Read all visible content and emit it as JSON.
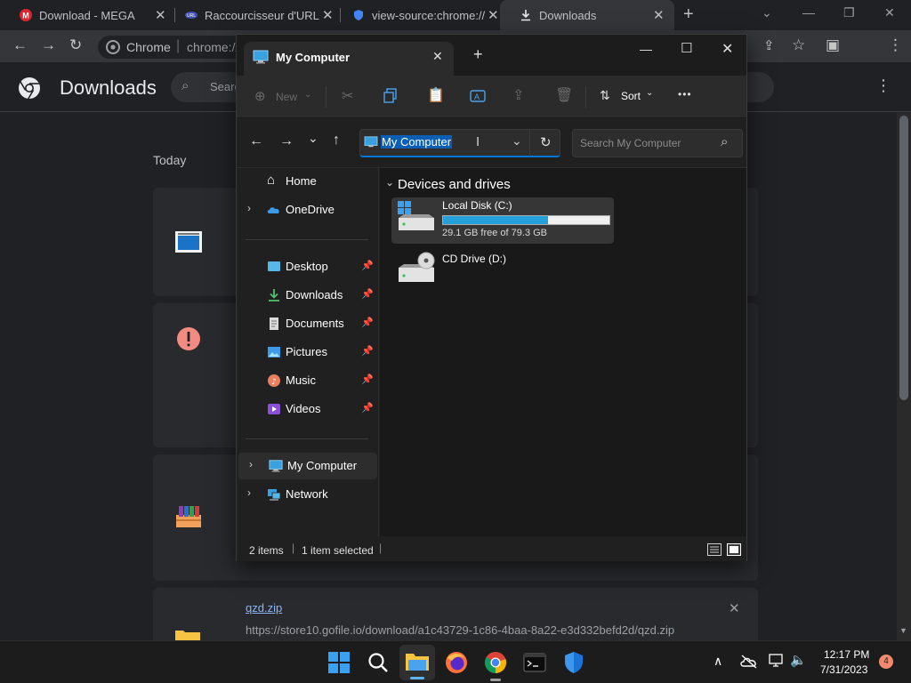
{
  "chrome": {
    "tabs": [
      {
        "title": "Download - MEGA"
      },
      {
        "title": "Raccourcisseur d'URL"
      },
      {
        "title": "view-source:chrome://"
      },
      {
        "title": "Downloads"
      }
    ],
    "new_tab": "+",
    "omnibox_label": "Chrome",
    "omnibox_url": "chrome://"
  },
  "downloads_page": {
    "title": "Downloads",
    "search_placeholder": "Search",
    "date_group": "Today",
    "last_item": {
      "name": "qzd.zip",
      "url": "https://store10.gofile.io/download/a1c43729-1c86-4baa-8a22-e3d332befd2d/qzd.zip"
    }
  },
  "explorer": {
    "tab_title": "My Computer",
    "toolbar": {
      "new_label": "New",
      "sort_label": "Sort",
      "more": "•••"
    },
    "address_value": "My Computer",
    "search_placeholder": "Search My Computer",
    "nav": {
      "home": "Home",
      "onedrive": "OneDrive",
      "desktop": "Desktop",
      "downloads": "Downloads",
      "documents": "Documents",
      "pictures": "Pictures",
      "music": "Music",
      "videos": "Videos",
      "my_computer": "My Computer",
      "network": "Network"
    },
    "group_header": "Devices and drives",
    "drives": [
      {
        "name": "Local Disk (C:)",
        "free_text": "29.1 GB free of 79.3 GB",
        "used_fraction": 0.633
      },
      {
        "name": "CD Drive (D:)"
      }
    ],
    "status": {
      "items": "2 items",
      "selected": "1 item selected"
    }
  },
  "taskbar": {
    "time": "12:17 PM",
    "date": "7/31/2023",
    "notification_count": "4"
  },
  "colors": {
    "accent": "#0078d4",
    "drive_bar": "#26a0da",
    "mega_red": "#d9272e"
  }
}
